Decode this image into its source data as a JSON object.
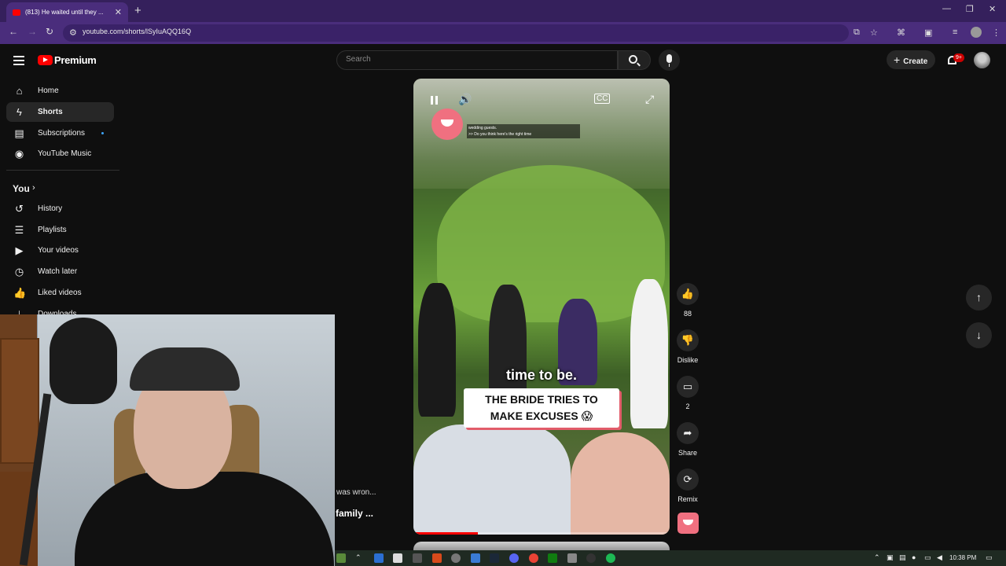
{
  "browser": {
    "tab_title": "(813) He waited until they ...",
    "url": "youtube.com/shorts/lSyIuAQQ16Q",
    "new_tab": "+",
    "close_tab": "✕"
  },
  "masthead": {
    "logo_text": "Premium",
    "search_placeholder": "Search",
    "create_label": "Create",
    "notification_badge": "9+"
  },
  "sidebar": {
    "items": [
      {
        "label": "Home",
        "icon": "home-icon"
      },
      {
        "label": "Shorts",
        "icon": "shorts-icon",
        "active": true
      },
      {
        "label": "Subscriptions",
        "icon": "subscriptions-icon"
      },
      {
        "label": "YouTube Music",
        "icon": "youtube-music-icon"
      }
    ],
    "you_label": "You",
    "you_items": [
      {
        "label": "History",
        "icon": "history-icon"
      },
      {
        "label": "Playlists",
        "icon": "playlists-icon"
      },
      {
        "label": "Your videos",
        "icon": "your-videos-icon"
      },
      {
        "label": "Watch later",
        "icon": "watch-later-icon"
      },
      {
        "label": "Liked videos",
        "icon": "liked-videos-icon"
      },
      {
        "label": "Downloads",
        "icon": "downloads-icon"
      }
    ]
  },
  "short": {
    "subtitle_line1": "wedding guests.",
    "subtitle_line2": ">> Do you think here's the right time",
    "caption": "time to be.",
    "title_line1": "THE BRIDE TRIES TO",
    "title_line2": "MAKE EXCUSES 😱",
    "progress": 0.25
  },
  "actions": {
    "like_count": "88",
    "dislike_label": "Dislike",
    "comment_count": "2",
    "share_label": "Share",
    "remix_label": "Remix"
  },
  "background_text": {
    "line1": "was wron...",
    "line2": "family ..."
  },
  "taskbar": {
    "clock": "10:38 PM"
  },
  "colors": {
    "browser_frame": "#4a2d7c",
    "yt_red": "#ff0000",
    "page_bg": "#0f0f0f",
    "brand_pink": "#f07080"
  }
}
